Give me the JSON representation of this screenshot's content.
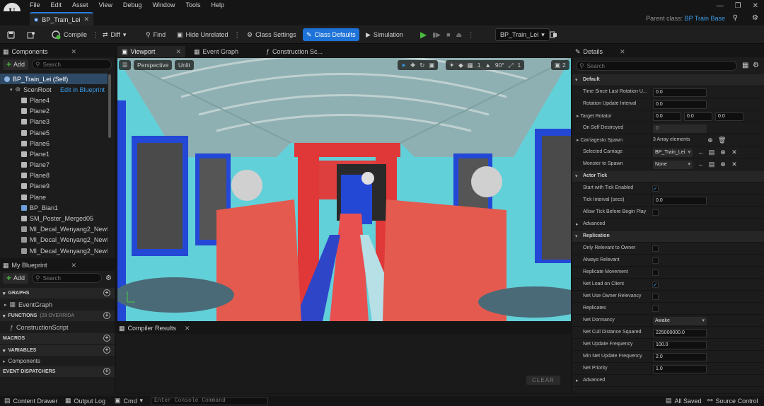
{
  "app": {
    "logo_glyph": "U",
    "menu": [
      "File",
      "Edit",
      "Asset",
      "View",
      "Debug",
      "Window",
      "Tools",
      "Help"
    ],
    "doc_tab": "BP_Train_Lei",
    "parent_class_label": "Parent class:",
    "parent_class": "BP Train Base"
  },
  "toolbar": {
    "compile": "Compile",
    "diff": "Diff",
    "find": "Find",
    "hide_unrelated": "Hide Unrelated",
    "class_settings": "Class Settings",
    "class_defaults": "Class Defaults",
    "simulation": "Simulation",
    "debug_object": "BP_Train_Lei",
    "colors": {
      "accent": "#1e73d8",
      "play": "#4cba3f"
    }
  },
  "components": {
    "title": "Components",
    "add_label": "Add",
    "search_placeholder": "Search",
    "self_item": "BP_Train_Lei (Self)",
    "root": "ScenRoot",
    "edit_link": "Edit in Blueprint",
    "items": [
      "Plane4",
      "Plane2",
      "Plane3",
      "Plane5",
      "Plane6",
      "Plane1",
      "Plane7",
      "Plane8",
      "Plane9",
      "Plane",
      "BP_Bian1",
      "SM_Poster_Merged05",
      "MI_Decal_Wenyang2_NewDe",
      "MI_Decal_Wenyang2_NewDe",
      "MI_Decal_Wenyang2_NewDe"
    ]
  },
  "my_blueprint": {
    "title": "My Blueprint",
    "add_label": "Add",
    "search_placeholder": "Search",
    "graphs_label": "GRAPHS",
    "event_graph": "EventGraph",
    "functions_label": "FUNCTIONS",
    "functions_count": "(28 OVERRIDA",
    "construction_script": "ConstructionScript",
    "macros_label": "MACROS",
    "variables_label": "VARIABLES",
    "components_label": "Components",
    "event_dispatchers_label": "EVENT DISPATCHERS"
  },
  "editor_tabs": [
    "Viewport",
    "Event Graph",
    "Construction Sc..."
  ],
  "viewport": {
    "perspective": "Perspective",
    "lit_mode": "Unlit",
    "grid_value": "1",
    "angle_value": "90°",
    "scale_value": "1",
    "camera_speed": "2"
  },
  "compiler": {
    "title": "Compiler Results",
    "clear_label": "CLEAR"
  },
  "details": {
    "title": "Details",
    "search_placeholder": "Search",
    "sections": {
      "default": "Default",
      "actor_tick": "Actor Tick",
      "advanced": "Advanced",
      "replication": "Replication",
      "advanced2": "Advanced"
    },
    "default_rows": {
      "time_since_label": "Time Since Last Rotation U...",
      "time_since_value": "0.0",
      "rotation_interval_label": "Rotation Update Interval",
      "rotation_interval_value": "0.0",
      "target_rotator_label": "Target Rotator",
      "target_rotator_x": "0.0",
      "target_rotator_y": "0.0",
      "target_rotator_z": "0.0",
      "on_self_destroyed_label": "On Self Destroyed",
      "on_self_destroyed_value": "0",
      "carriages_spawn_label": "Carriagesto Spawn",
      "carriages_spawn_value": "3 Array elements",
      "selected_carriage_label": "Selected Carriage",
      "selected_carriage_value": "BP_Train_Lei",
      "monster_label": "Monster to Spawn",
      "monster_value": "None"
    },
    "tick_rows": {
      "start_tick_label": "Start with Tick Enabled",
      "start_tick_checked": true,
      "tick_interval_label": "Tick Interval (secs)",
      "tick_interval_value": "0.0",
      "allow_tick_label": "Allow Tick Before Begin Play",
      "allow_tick_checked": false
    },
    "replication_rows": {
      "only_relevant_label": "Only Relevant to Owner",
      "always_relevant_label": "Always Relevant",
      "replicate_movement_label": "Replicate Movement",
      "net_load_label": "Net Load on Client",
      "net_load_checked": true,
      "net_use_owner_label": "Net Use Owner Relevancy",
      "replicates_label": "Replicates",
      "net_dormancy_label": "Net Dormancy",
      "net_dormancy_value": "Awake",
      "net_cull_label": "Net Cull Distance Squared",
      "net_cull_value": "225000000.0",
      "net_update_freq_label": "Net Update Frequency",
      "net_update_freq_value": "100.0",
      "min_net_update_label": "Min Net Update Frequency",
      "min_net_update_value": "2.0",
      "net_priority_label": "Net Priority",
      "net_priority_value": "1.0"
    }
  },
  "status": {
    "content_drawer": "Content Drawer",
    "output_log": "Output Log",
    "cmd": "Cmd",
    "console_placeholder": "Enter Console Command",
    "all_saved": "All Saved",
    "source_control": "Source Control"
  }
}
